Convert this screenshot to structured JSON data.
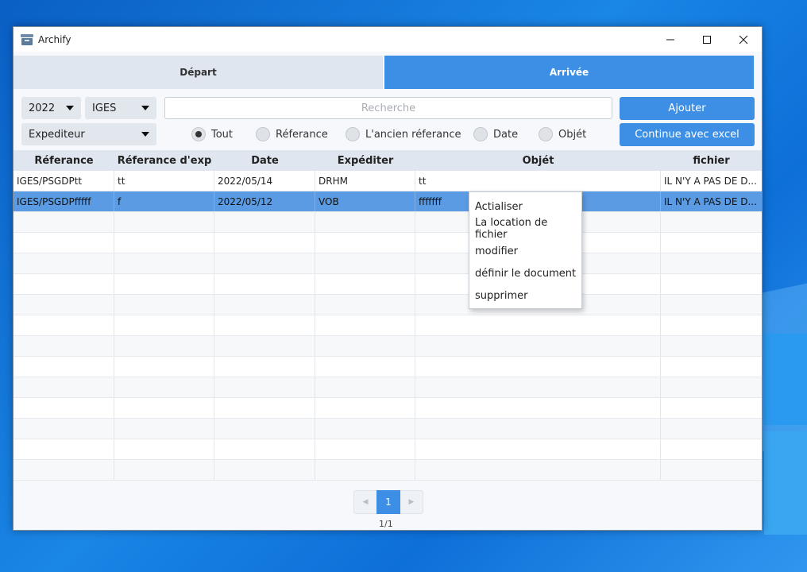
{
  "window": {
    "title": "Archify"
  },
  "tabs": [
    {
      "label": "Départ",
      "active": false
    },
    {
      "label": "Arrivée",
      "active": true
    }
  ],
  "toolbar": {
    "year": "2022",
    "org": "IGES",
    "type": "Expediteur",
    "search_placeholder": "Recherche",
    "search_value": "",
    "add_label": "Ajouter",
    "excel_label": "Continue avec excel"
  },
  "filters": [
    {
      "label": "Tout",
      "checked": true
    },
    {
      "label": "Réferance",
      "checked": false
    },
    {
      "label": "L'ancien réferance",
      "checked": false
    },
    {
      "label": "Date",
      "checked": false
    },
    {
      "label": "Objét",
      "checked": false
    }
  ],
  "table": {
    "columns": [
      "Réferance",
      "Réferance d'exp",
      "Date",
      "Expéditer",
      "Objét",
      "fichier"
    ],
    "rows": [
      [
        "IGES/PSGDPtt",
        "tt",
        "2022/05/14",
        "DRHM",
        "tt",
        "IL N'Y A PAS DE D..."
      ],
      [
        "IGES/PSGDPfffff",
        "f",
        "2022/05/12",
        "VOB",
        "fffffff",
        "IL N'Y A PAS DE D..."
      ]
    ],
    "selected_row": 1
  },
  "pagination": {
    "current": "1",
    "info": "1/1"
  },
  "context_menu": {
    "items": [
      "Actialiser",
      "La location de fichier",
      "modifier",
      "définir le document",
      "supprimer"
    ]
  },
  "colors": {
    "accent": "#3d8fe6",
    "tab_inactive": "#dfe6ef",
    "selected_row": "#5a9be3"
  }
}
